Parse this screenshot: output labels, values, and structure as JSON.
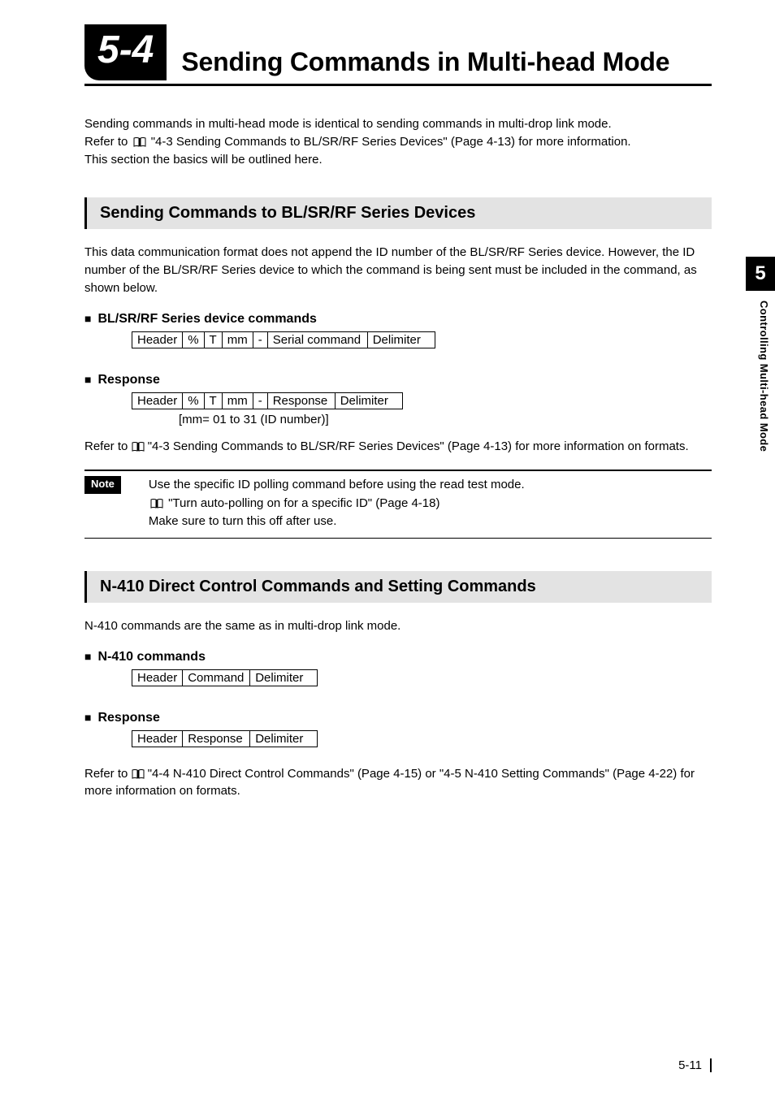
{
  "section_number": "5-4",
  "section_title": "Sending Commands in Multi-head Mode",
  "intro_p1": "Sending commands in multi-head mode is identical to sending commands in multi-drop link mode.",
  "intro_p2a": "Refer to ",
  "intro_p2b": "\"4-3 Sending Commands to BL/SR/RF Series Devices\" (Page 4-13)  for more information.",
  "intro_p3": "This section the basics will be outlined here.",
  "sec1": {
    "heading": "Sending Commands to BL/SR/RF Series Devices",
    "body": "This data communication format does not append the ID number of the BL/SR/RF Series device. However, the ID number of the BL/SR/RF Series device to which the command is being sent must be included in the command, as shown below.",
    "sub1": "BL/SR/RF Series device commands",
    "table1": [
      "Header",
      "%",
      "T",
      "mm",
      "-",
      "Serial command",
      "Delimiter"
    ],
    "sub2": "Response",
    "table2": [
      "Header",
      "%",
      "T",
      "mm",
      "-",
      "Response",
      "Delimiter"
    ],
    "caption2": "[mm= 01 to 31 (ID number)]",
    "body2a": "Refer to ",
    "body2b": "\"4-3 Sending Commands to BL/SR/RF Series Devices\" (Page 4-13)  for more information on formats.",
    "note_label": "Note",
    "note_l1": "Use the specific ID polling command before using the read test mode.",
    "note_l2": "\"Turn auto-polling on for a specific ID\" (Page 4-18)",
    "note_l3": "Make sure to turn this off after use."
  },
  "sec2": {
    "heading": "N-410 Direct Control Commands and Setting Commands",
    "body": "N-410 commands are the same as in multi-drop link mode.",
    "sub1": "N-410 commands",
    "table1": [
      "Header",
      "Command",
      "Delimiter"
    ],
    "sub2": "Response",
    "table2": [
      "Header",
      "Response",
      "Delimiter"
    ],
    "body2a": "Refer to ",
    "body2b": "\"4-4 N-410 Direct Control Commands\" (Page 4-15)  or \"4-5 N-410 Setting Commands\" (Page 4-22)  for more information on formats."
  },
  "side": {
    "tab": "5",
    "label": "Controlling Multi-head Mode"
  },
  "page_number": "5-11"
}
